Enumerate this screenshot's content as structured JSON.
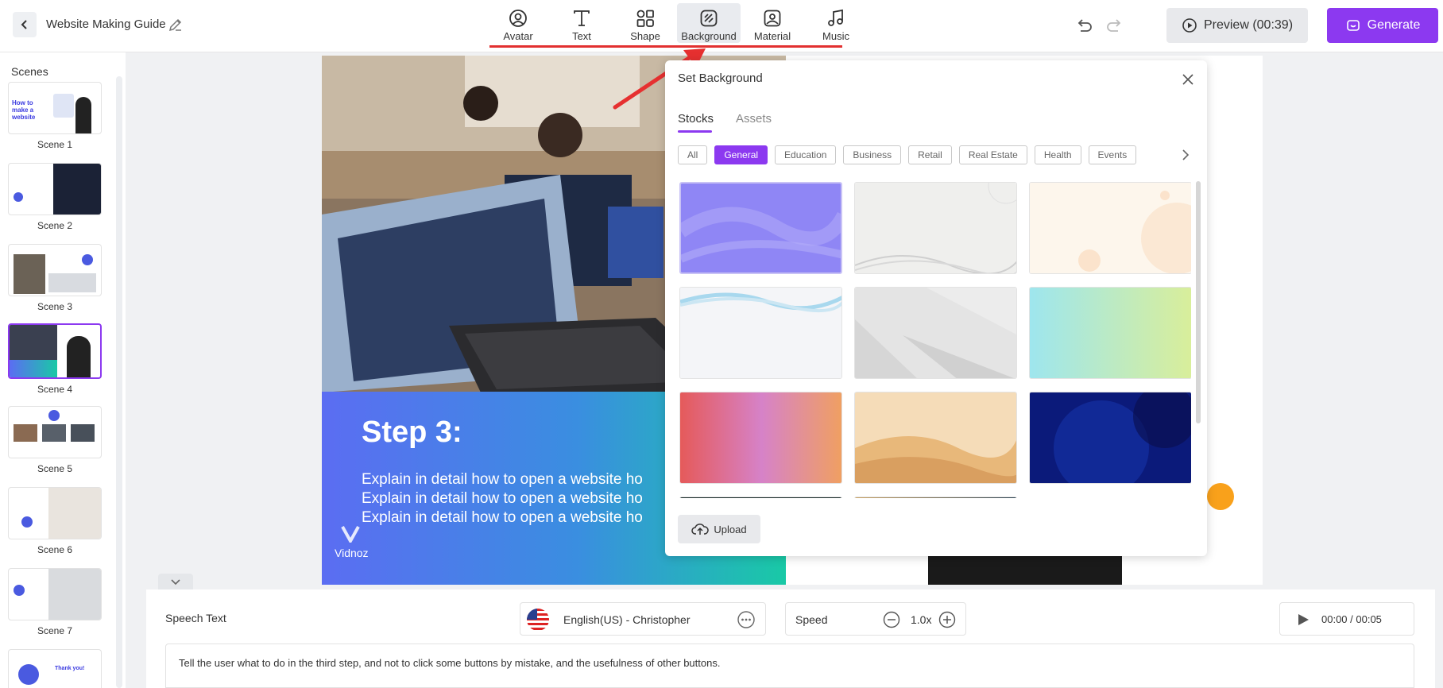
{
  "header": {
    "project_title": "Website Making Guide",
    "tools": [
      {
        "label": "Avatar",
        "icon": "avatar-icon"
      },
      {
        "label": "Text",
        "icon": "text-icon"
      },
      {
        "label": "Shape",
        "icon": "shape-icon"
      },
      {
        "label": "Background",
        "icon": "background-icon",
        "active": true
      },
      {
        "label": "Material",
        "icon": "material-icon"
      },
      {
        "label": "Music",
        "icon": "music-icon"
      }
    ],
    "preview_label": "Preview (00:39)",
    "generate_label": "Generate",
    "accent_color": "#8c39f0"
  },
  "sidebar": {
    "title": "Scenes",
    "scenes": [
      {
        "label": "Scene 1",
        "thumb_text": "How to make a website"
      },
      {
        "label": "Scene 2"
      },
      {
        "label": "Scene 3"
      },
      {
        "label": "Scene 4",
        "active": true
      },
      {
        "label": "Scene 5"
      },
      {
        "label": "Scene 6"
      },
      {
        "label": "Scene 7"
      },
      {
        "label": "",
        "thumb_text": "Thank you!"
      }
    ]
  },
  "canvas": {
    "step_title": "Step 3:",
    "lines": [
      "Explain in detail how to open a website ho",
      "Explain in detail how to open a website ho",
      "Explain in detail how to open a website ho"
    ],
    "logo_text": "Vidnoz"
  },
  "modal": {
    "title": "Set Background",
    "tabs": [
      "Stocks",
      "Assets"
    ],
    "active_tab": "Stocks",
    "chips": [
      "All",
      "General",
      "Education",
      "Business",
      "Retail",
      "Real Estate",
      "Health",
      "Events"
    ],
    "active_chip": "General",
    "upload_label": "Upload"
  },
  "bottom": {
    "speech_label": "Speech Text",
    "voice": "English(US) - Christopher",
    "speed_label": "Speed",
    "speed_value": "1.0x",
    "time": "00:00 / 00:05",
    "speech_text": "Tell the user what to do in the third step, and not to click some buttons by mistake, and the usefulness of other buttons."
  }
}
